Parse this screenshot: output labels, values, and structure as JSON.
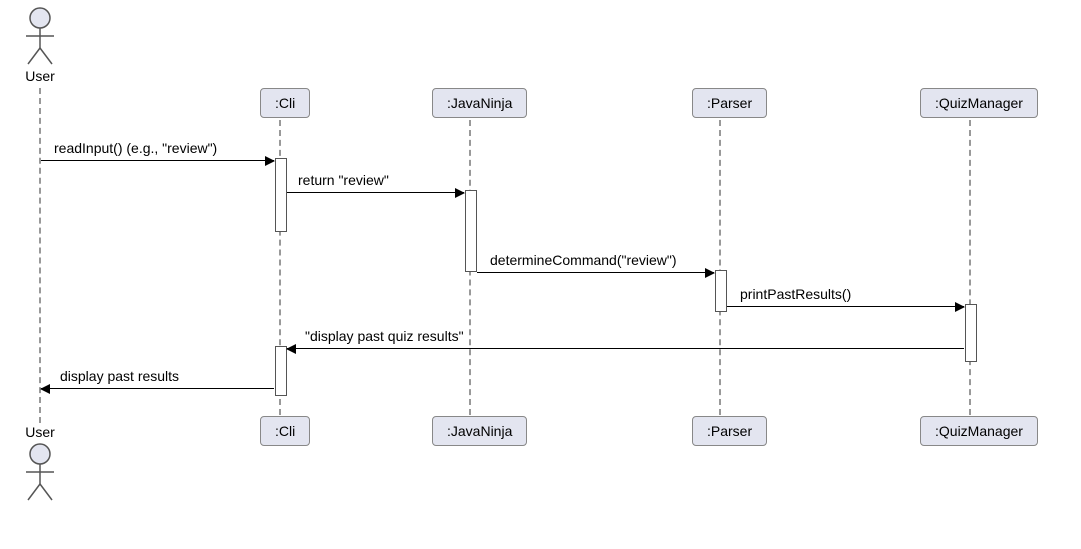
{
  "diagram_type": "UML Sequence Diagram",
  "actor": {
    "name": "User"
  },
  "participants": {
    "cli": ":Cli",
    "javaninja": ":JavaNinja",
    "parser": ":Parser",
    "quizmanager": ":QuizManager"
  },
  "messages": {
    "m1": "readInput() (e.g., \"review\")",
    "m2": "return \"review\"",
    "m3": "determineCommand(\"review\")",
    "m4": "printPastResults()",
    "m5": "\"display past quiz results\"",
    "m6": "display past results"
  },
  "chart_data": {
    "type": "sequence-diagram",
    "actors": [
      "User"
    ],
    "participants": [
      ":Cli",
      ":JavaNinja",
      ":Parser",
      ":QuizManager"
    ],
    "interactions": [
      {
        "from": "User",
        "to": ":Cli",
        "label": "readInput() (e.g., \"review\")",
        "kind": "sync"
      },
      {
        "from": ":Cli",
        "to": ":JavaNinja",
        "label": "return \"review\"",
        "kind": "sync"
      },
      {
        "from": ":JavaNinja",
        "to": ":Parser",
        "label": "determineCommand(\"review\")",
        "kind": "sync"
      },
      {
        "from": ":Parser",
        "to": ":QuizManager",
        "label": "printPastResults()",
        "kind": "sync"
      },
      {
        "from": ":QuizManager",
        "to": ":Cli",
        "label": "\"display past quiz results\"",
        "kind": "sync"
      },
      {
        "from": ":Cli",
        "to": "User",
        "label": "display past results",
        "kind": "sync"
      }
    ]
  }
}
